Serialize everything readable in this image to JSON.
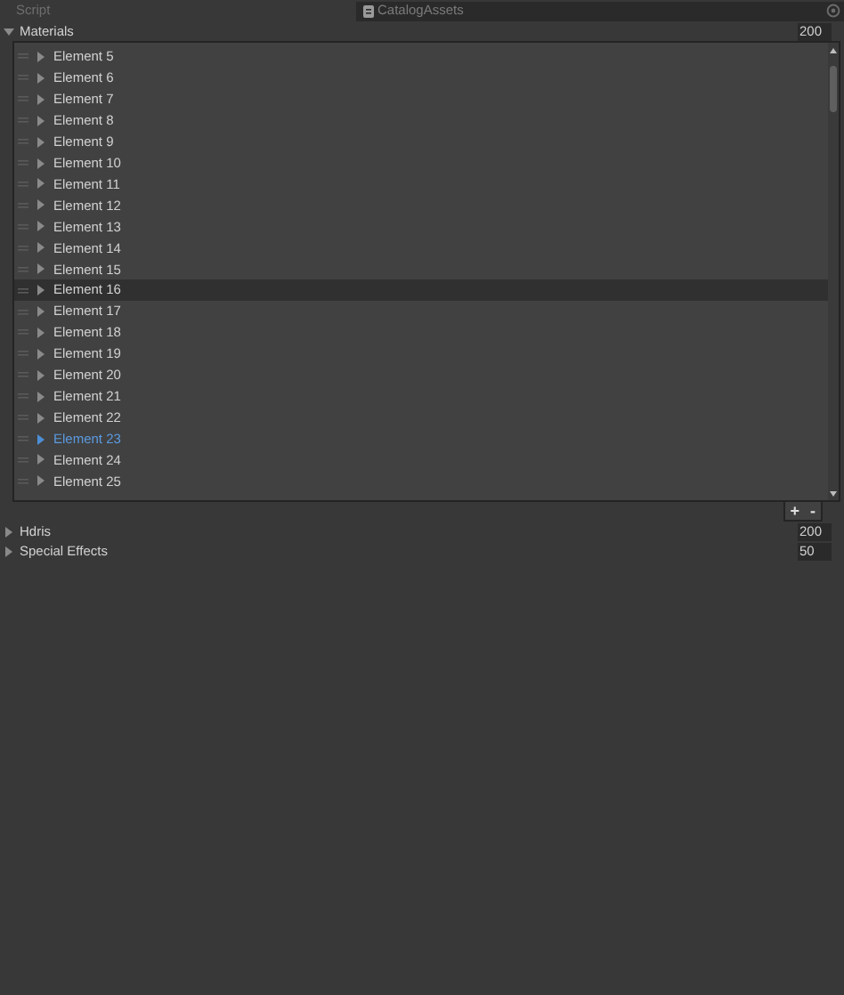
{
  "script_field": {
    "label": "Script",
    "value": "CatalogAssets",
    "disabled": true
  },
  "lists": [
    {
      "label": "Materials",
      "expanded": true,
      "size": "200",
      "elements": [
        {
          "label": "Element 5",
          "hovered": false,
          "selected": false
        },
        {
          "label": "Element 6",
          "hovered": false,
          "selected": false
        },
        {
          "label": "Element 7",
          "hovered": false,
          "selected": false
        },
        {
          "label": "Element 8",
          "hovered": false,
          "selected": false
        },
        {
          "label": "Element 9",
          "hovered": false,
          "selected": false
        },
        {
          "label": "Element 10",
          "hovered": false,
          "selected": false
        },
        {
          "label": "Element 11",
          "hovered": false,
          "selected": false
        },
        {
          "label": "Element 12",
          "hovered": false,
          "selected": false
        },
        {
          "label": "Element 13",
          "hovered": false,
          "selected": false
        },
        {
          "label": "Element 14",
          "hovered": false,
          "selected": false
        },
        {
          "label": "Element 15",
          "hovered": false,
          "selected": false
        },
        {
          "label": "Element 16",
          "hovered": true,
          "selected": false
        },
        {
          "label": "Element 17",
          "hovered": false,
          "selected": false
        },
        {
          "label": "Element 18",
          "hovered": false,
          "selected": false
        },
        {
          "label": "Element 19",
          "hovered": false,
          "selected": false
        },
        {
          "label": "Element 20",
          "hovered": false,
          "selected": false
        },
        {
          "label": "Element 21",
          "hovered": false,
          "selected": false
        },
        {
          "label": "Element 22",
          "hovered": false,
          "selected": false
        },
        {
          "label": "Element 23",
          "hovered": false,
          "selected": true
        },
        {
          "label": "Element 24",
          "hovered": false,
          "selected": false
        },
        {
          "label": "Element 25",
          "hovered": false,
          "selected": false
        }
      ],
      "add": "+",
      "remove": "-"
    },
    {
      "label": "Hdris",
      "expanded": false,
      "size": "200"
    },
    {
      "label": "Special Effects",
      "expanded": false,
      "size": "50"
    }
  ]
}
